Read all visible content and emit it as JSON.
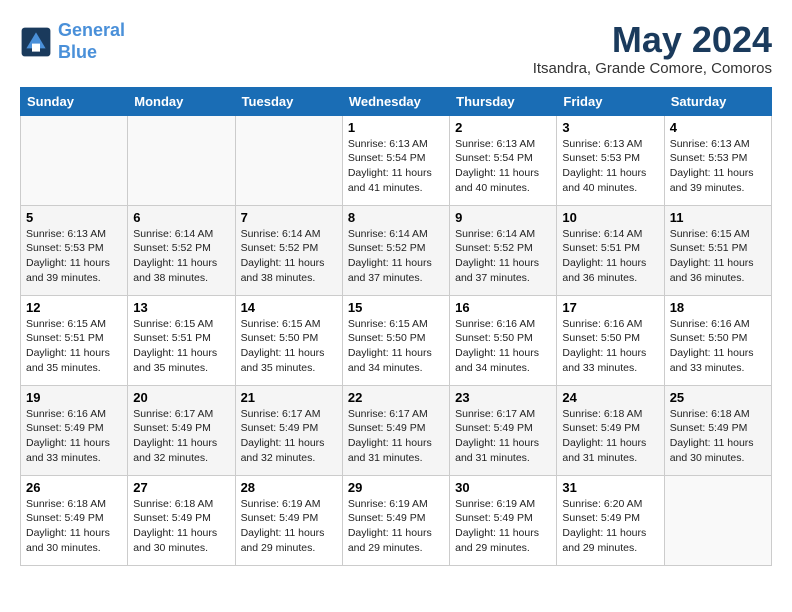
{
  "logo": {
    "line1": "General",
    "line2": "Blue"
  },
  "title": "May 2024",
  "subtitle": "Itsandra, Grande Comore, Comoros",
  "days_of_week": [
    "Sunday",
    "Monday",
    "Tuesday",
    "Wednesday",
    "Thursday",
    "Friday",
    "Saturday"
  ],
  "weeks": [
    [
      {
        "day": "",
        "info": ""
      },
      {
        "day": "",
        "info": ""
      },
      {
        "day": "",
        "info": ""
      },
      {
        "day": "1",
        "info": "Sunrise: 6:13 AM\nSunset: 5:54 PM\nDaylight: 11 hours\nand 41 minutes."
      },
      {
        "day": "2",
        "info": "Sunrise: 6:13 AM\nSunset: 5:54 PM\nDaylight: 11 hours\nand 40 minutes."
      },
      {
        "day": "3",
        "info": "Sunrise: 6:13 AM\nSunset: 5:53 PM\nDaylight: 11 hours\nand 40 minutes."
      },
      {
        "day": "4",
        "info": "Sunrise: 6:13 AM\nSunset: 5:53 PM\nDaylight: 11 hours\nand 39 minutes."
      }
    ],
    [
      {
        "day": "5",
        "info": "Sunrise: 6:13 AM\nSunset: 5:53 PM\nDaylight: 11 hours\nand 39 minutes."
      },
      {
        "day": "6",
        "info": "Sunrise: 6:14 AM\nSunset: 5:52 PM\nDaylight: 11 hours\nand 38 minutes."
      },
      {
        "day": "7",
        "info": "Sunrise: 6:14 AM\nSunset: 5:52 PM\nDaylight: 11 hours\nand 38 minutes."
      },
      {
        "day": "8",
        "info": "Sunrise: 6:14 AM\nSunset: 5:52 PM\nDaylight: 11 hours\nand 37 minutes."
      },
      {
        "day": "9",
        "info": "Sunrise: 6:14 AM\nSunset: 5:52 PM\nDaylight: 11 hours\nand 37 minutes."
      },
      {
        "day": "10",
        "info": "Sunrise: 6:14 AM\nSunset: 5:51 PM\nDaylight: 11 hours\nand 36 minutes."
      },
      {
        "day": "11",
        "info": "Sunrise: 6:15 AM\nSunset: 5:51 PM\nDaylight: 11 hours\nand 36 minutes."
      }
    ],
    [
      {
        "day": "12",
        "info": "Sunrise: 6:15 AM\nSunset: 5:51 PM\nDaylight: 11 hours\nand 35 minutes."
      },
      {
        "day": "13",
        "info": "Sunrise: 6:15 AM\nSunset: 5:51 PM\nDaylight: 11 hours\nand 35 minutes."
      },
      {
        "day": "14",
        "info": "Sunrise: 6:15 AM\nSunset: 5:50 PM\nDaylight: 11 hours\nand 35 minutes."
      },
      {
        "day": "15",
        "info": "Sunrise: 6:15 AM\nSunset: 5:50 PM\nDaylight: 11 hours\nand 34 minutes."
      },
      {
        "day": "16",
        "info": "Sunrise: 6:16 AM\nSunset: 5:50 PM\nDaylight: 11 hours\nand 34 minutes."
      },
      {
        "day": "17",
        "info": "Sunrise: 6:16 AM\nSunset: 5:50 PM\nDaylight: 11 hours\nand 33 minutes."
      },
      {
        "day": "18",
        "info": "Sunrise: 6:16 AM\nSunset: 5:50 PM\nDaylight: 11 hours\nand 33 minutes."
      }
    ],
    [
      {
        "day": "19",
        "info": "Sunrise: 6:16 AM\nSunset: 5:49 PM\nDaylight: 11 hours\nand 33 minutes."
      },
      {
        "day": "20",
        "info": "Sunrise: 6:17 AM\nSunset: 5:49 PM\nDaylight: 11 hours\nand 32 minutes."
      },
      {
        "day": "21",
        "info": "Sunrise: 6:17 AM\nSunset: 5:49 PM\nDaylight: 11 hours\nand 32 minutes."
      },
      {
        "day": "22",
        "info": "Sunrise: 6:17 AM\nSunset: 5:49 PM\nDaylight: 11 hours\nand 31 minutes."
      },
      {
        "day": "23",
        "info": "Sunrise: 6:17 AM\nSunset: 5:49 PM\nDaylight: 11 hours\nand 31 minutes."
      },
      {
        "day": "24",
        "info": "Sunrise: 6:18 AM\nSunset: 5:49 PM\nDaylight: 11 hours\nand 31 minutes."
      },
      {
        "day": "25",
        "info": "Sunrise: 6:18 AM\nSunset: 5:49 PM\nDaylight: 11 hours\nand 30 minutes."
      }
    ],
    [
      {
        "day": "26",
        "info": "Sunrise: 6:18 AM\nSunset: 5:49 PM\nDaylight: 11 hours\nand 30 minutes."
      },
      {
        "day": "27",
        "info": "Sunrise: 6:18 AM\nSunset: 5:49 PM\nDaylight: 11 hours\nand 30 minutes."
      },
      {
        "day": "28",
        "info": "Sunrise: 6:19 AM\nSunset: 5:49 PM\nDaylight: 11 hours\nand 29 minutes."
      },
      {
        "day": "29",
        "info": "Sunrise: 6:19 AM\nSunset: 5:49 PM\nDaylight: 11 hours\nand 29 minutes."
      },
      {
        "day": "30",
        "info": "Sunrise: 6:19 AM\nSunset: 5:49 PM\nDaylight: 11 hours\nand 29 minutes."
      },
      {
        "day": "31",
        "info": "Sunrise: 6:20 AM\nSunset: 5:49 PM\nDaylight: 11 hours\nand 29 minutes."
      },
      {
        "day": "",
        "info": ""
      }
    ]
  ]
}
